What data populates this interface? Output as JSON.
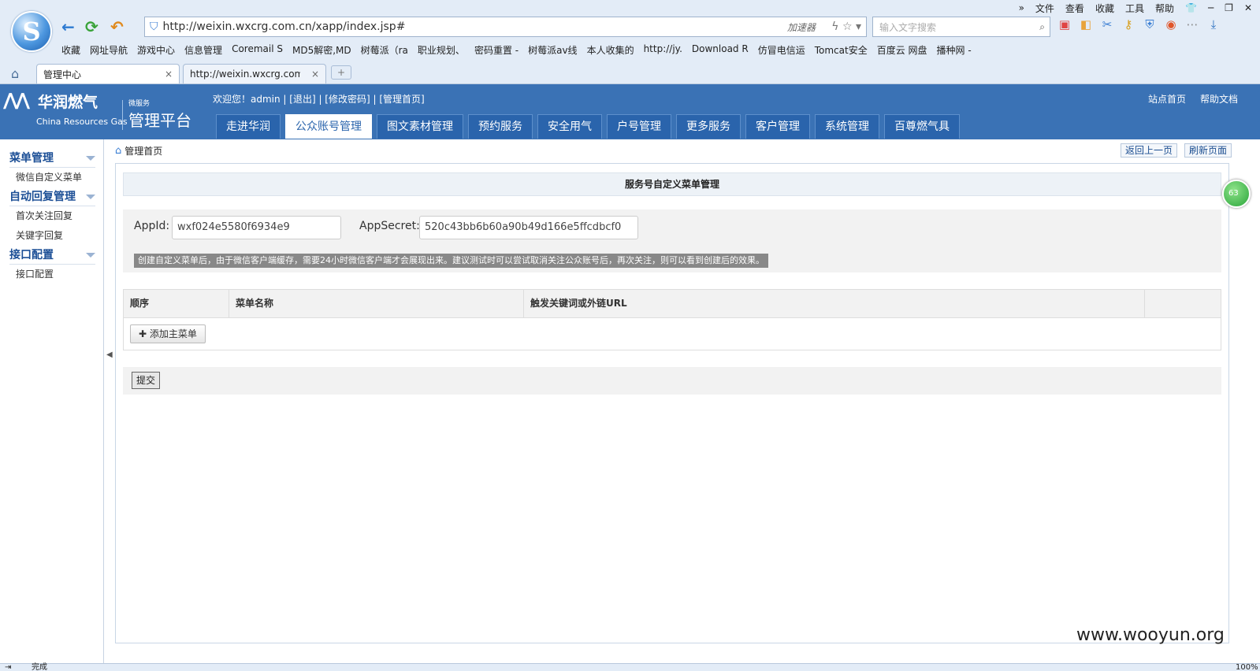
{
  "browser": {
    "menu": [
      "文件",
      "查看",
      "收藏",
      "工具",
      "帮助"
    ],
    "logo_letter": "S",
    "url": "http://weixin.wxcrg.com.cn/xapp/index.jsp#",
    "accelerator": "加速器",
    "search_placeholder": "输入文字搜索",
    "bookmarks": [
      "收藏",
      "网址导航",
      "游戏中心",
      "信息管理",
      "Coremail S",
      "MD5解密,MD",
      "树莓派（ra",
      "职业规划、",
      "密码重置 -",
      "树莓派av线",
      "本人收集的",
      "http://jy.",
      "Download R",
      "仿冒电信运",
      "Tomcat安全",
      "百度云 网盘",
      "播种网 -"
    ],
    "tabs": [
      {
        "label": "管理中心",
        "active": true
      },
      {
        "label": "http://weixin.wxcrg.com.cn",
        "active": false
      }
    ],
    "status": "完成",
    "zoom": "100%"
  },
  "header": {
    "brand_zh": "华润燃气",
    "brand_en": "China Resources Gas",
    "platform_small": "微服务",
    "platform_big": "管理平台",
    "welcome": "欢迎您！admin | [退出] | [修改密码] | [管理首页]",
    "toplinks": [
      "站点首页",
      "帮助文档"
    ],
    "nav": [
      {
        "label": "走进华润",
        "active": false
      },
      {
        "label": "公众账号管理",
        "active": true
      },
      {
        "label": "图文素材管理",
        "active": false
      },
      {
        "label": "预约服务",
        "active": false
      },
      {
        "label": "安全用气",
        "active": false
      },
      {
        "label": "户号管理",
        "active": false
      },
      {
        "label": "更多服务",
        "active": false
      },
      {
        "label": "客户管理",
        "active": false
      },
      {
        "label": "系统管理",
        "active": false
      },
      {
        "label": "百尊燃气具",
        "active": false
      }
    ]
  },
  "sidebar": {
    "groups": [
      {
        "title": "菜单管理",
        "items": [
          "微信自定义菜单"
        ]
      },
      {
        "title": "自动回复管理",
        "items": [
          "首次关注回复",
          "关键字回复"
        ]
      },
      {
        "title": "接口配置",
        "items": [
          "接口配置"
        ]
      }
    ]
  },
  "content": {
    "breadcrumb": "管理首页",
    "back_button": "返回上一页",
    "refresh_button": "刷新页面",
    "panel_title": "服务号自定义菜单管理",
    "appid_label": "AppId:",
    "appid_value": "wxf024e5580f6934e9",
    "appsecret_label": "AppSecret:",
    "appsecret_value": "520c43bb6b60a90b49d166e5ffcdbcf0",
    "notice": "创建自定义菜单后，由于微信客户端缓存，需要24小时微信客户端才会展现出来。建议测试时可以尝试取消关注公众账号后，再次关注，则可以看到创建后的效果。",
    "columns": [
      "顺序",
      "菜单名称",
      "触发关键词或外链URL",
      ""
    ],
    "add_button": "添加主菜单",
    "submit_button": "提交"
  },
  "badge": "63",
  "watermark": "www.wooyun.org"
}
